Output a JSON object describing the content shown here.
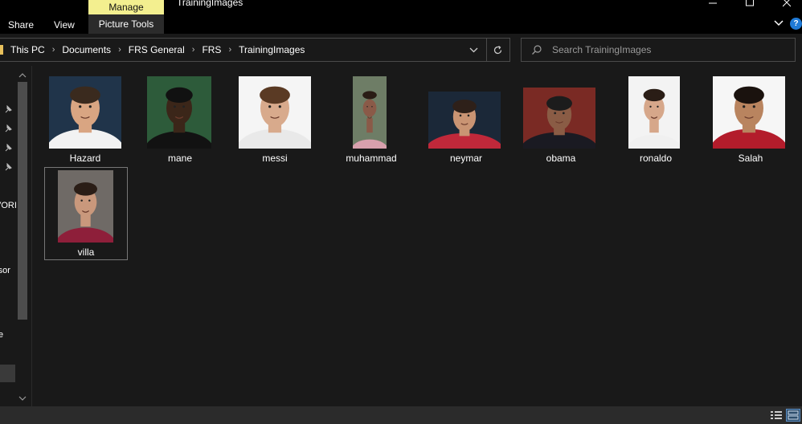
{
  "window": {
    "title": "TrainingImages",
    "contextual_tab_group": "Manage",
    "contextual_tab": "Picture Tools",
    "ribbon_tabs": [
      "Share",
      "View"
    ],
    "controls": [
      "minimize",
      "maximize",
      "close"
    ]
  },
  "address": {
    "breadcrumb": [
      "This PC",
      "Documents",
      "FRS General",
      "FRS",
      "TrainingImages"
    ]
  },
  "search": {
    "placeholder": "Search TrainingImages"
  },
  "nav": {
    "labels": [
      "VORI",
      "rsor",
      "e"
    ]
  },
  "files": [
    {
      "name": "Hazard",
      "bg": "#20344a",
      "skin": "#d9a582",
      "hair": "#3a2a1e",
      "shirt": "#f2f2f2"
    },
    {
      "name": "mane",
      "bg": "#2d5b3a",
      "skin": "#3b2619",
      "hair": "#111111",
      "shirt": "#121212"
    },
    {
      "name": "messi",
      "bg": "#f5f5f5",
      "skin": "#d8aa8c",
      "hair": "#5a3a24",
      "shirt": "#e9e9e9"
    },
    {
      "name": "muhammad",
      "bg": "#6e7d66",
      "skin": "#8a5a48",
      "hair": "#2a1c15",
      "shirt": "#d8a0ad"
    },
    {
      "name": "neymar",
      "bg": "#1b2838",
      "skin": "#c99473",
      "hair": "#2e2019",
      "shirt": "#c0283a"
    },
    {
      "name": "obama",
      "bg": "#7a2a24",
      "skin": "#8a5c45",
      "hair": "#1c1c1c",
      "shirt": "#1a1a22"
    },
    {
      "name": "ronaldo",
      "bg": "#f3f3f3",
      "skin": "#d6a78a",
      "hair": "#2a1d16",
      "shirt": "#f0f0f0"
    },
    {
      "name": "Salah",
      "bg": "#f6f6f6",
      "skin": "#b9845f",
      "hair": "#1a120e",
      "shirt": "#b31c2b"
    },
    {
      "name": "villa",
      "bg": "#6f6a66",
      "skin": "#c9987c",
      "hair": "#2a1d16",
      "shirt": "#8e1f3a"
    }
  ],
  "colors": {
    "background": "#191919",
    "titlebar": "#000000",
    "manage_accent": "#f3ef8f",
    "help_blue": "#1f7ad6"
  },
  "icons": [
    "chevron-right-icon",
    "chevron-down-icon",
    "refresh-icon",
    "search-icon",
    "pin-icon",
    "help-icon",
    "details-view-icon",
    "large-icons-view-icon"
  ]
}
